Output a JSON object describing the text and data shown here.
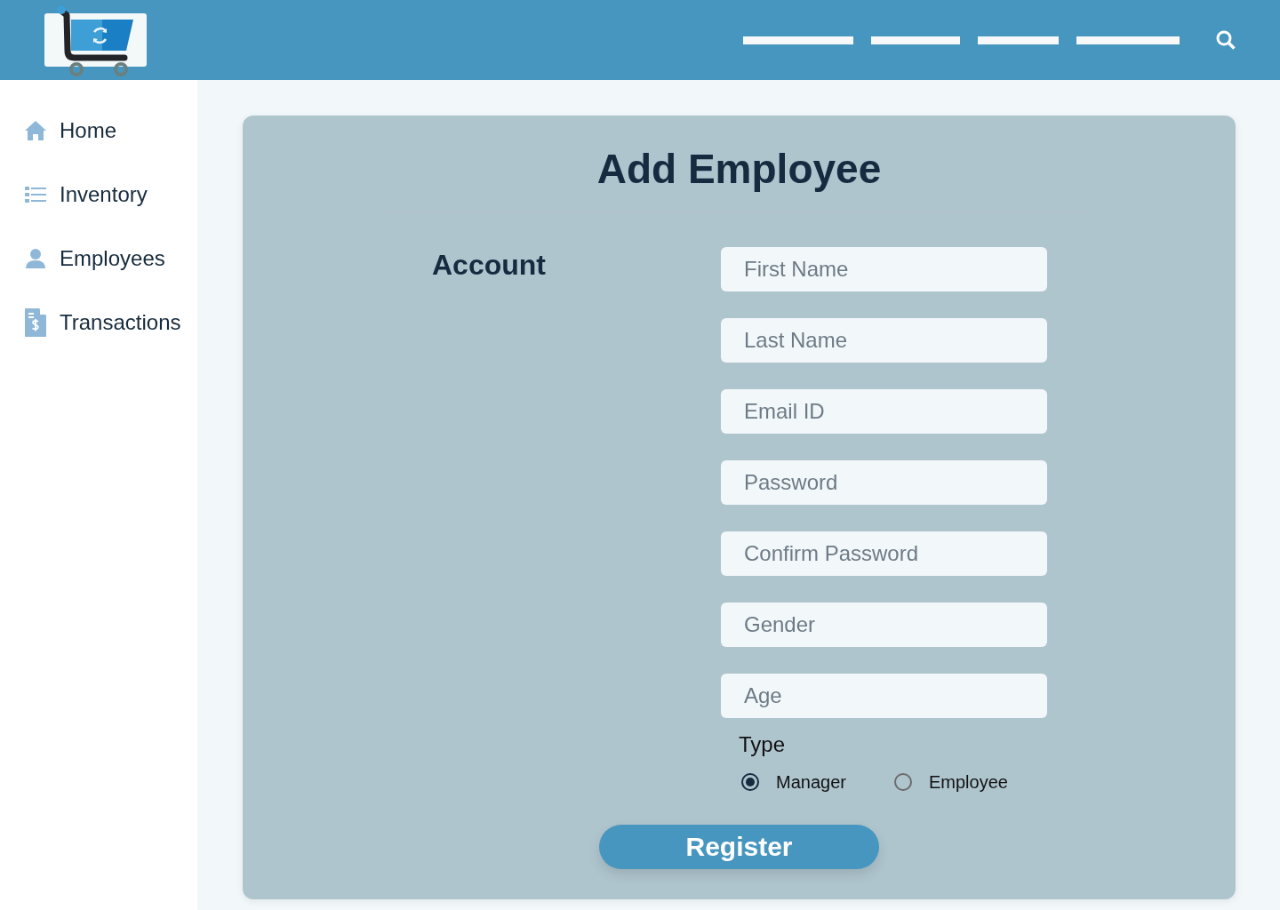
{
  "sidebar": {
    "items": [
      {
        "label": "Home",
        "kind": "home"
      },
      {
        "label": "Inventory",
        "kind": "list"
      },
      {
        "label": "Employees",
        "kind": "person"
      },
      {
        "label": "Transactions",
        "kind": "invoice"
      }
    ]
  },
  "form": {
    "title": "Add Employee",
    "section_label": "Account",
    "fields": [
      {
        "placeholder": "First Name"
      },
      {
        "placeholder": "Last Name"
      },
      {
        "placeholder": "Email ID"
      },
      {
        "placeholder": "Password"
      },
      {
        "placeholder": "Confirm Password"
      },
      {
        "placeholder": "Gender"
      },
      {
        "placeholder": "Age"
      }
    ],
    "type_group": {
      "label": "Type",
      "options": [
        {
          "label": "Manager",
          "selected": true
        },
        {
          "label": "Employee",
          "selected": false
        }
      ]
    },
    "submit_button": "Register"
  }
}
